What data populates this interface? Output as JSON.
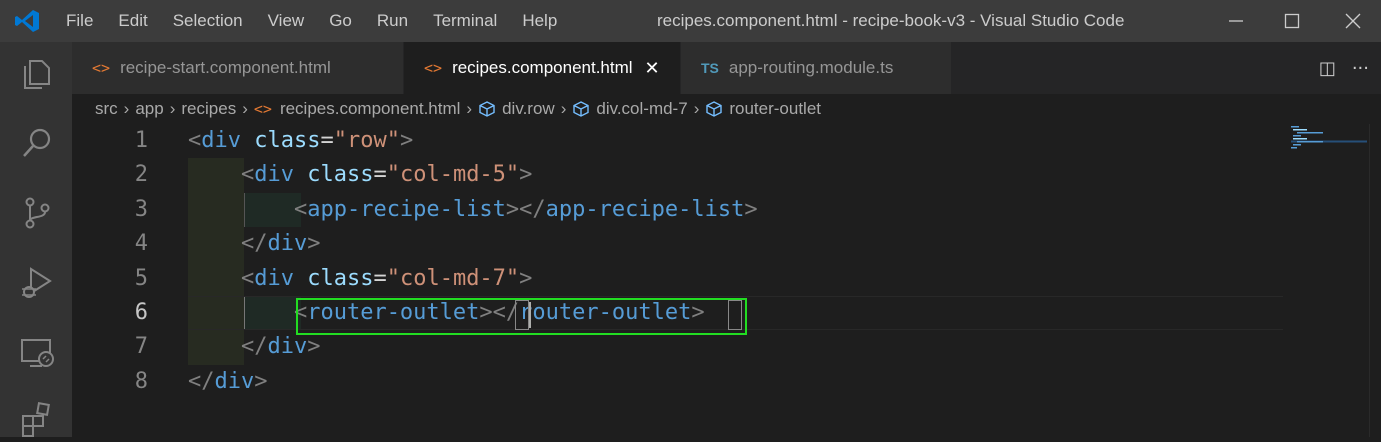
{
  "titlebar": {
    "menu": [
      "File",
      "Edit",
      "Selection",
      "View",
      "Go",
      "Run",
      "Terminal",
      "Help"
    ],
    "window_title": "recipes.component.html - recipe-book-v3 - Visual Studio Code",
    "minimize": "—",
    "maximize": "☐",
    "close": "✕"
  },
  "activity_bar": {
    "items": [
      "explorer-icon",
      "search-icon",
      "source-control-icon",
      "run-debug-icon",
      "remote-explorer-icon",
      "extensions-icon"
    ]
  },
  "tabs": [
    {
      "icon": "<>",
      "label": "recipe-start.component.html",
      "active": false
    },
    {
      "icon": "<>",
      "label": "recipes.component.html",
      "active": true,
      "close": "✕"
    },
    {
      "icon": "TS",
      "label": "app-routing.module.ts",
      "active": false
    }
  ],
  "tab_actions": {
    "split": "◫",
    "more": "···"
  },
  "breadcrumb": {
    "parts": [
      "src",
      "app",
      "recipes",
      "recipes.component.html",
      "div.row",
      "div.col-md-7",
      "router-outlet"
    ],
    "file_icon": "<>",
    "sep": "›"
  },
  "editor": {
    "line_numbers": [
      "1",
      "2",
      "3",
      "4",
      "5",
      "6",
      "7",
      "8"
    ],
    "active_line": "6",
    "lines": [
      [
        [
          "p",
          "<"
        ],
        [
          "t",
          "div"
        ],
        [
          "e",
          " "
        ],
        [
          "a",
          "class"
        ],
        [
          "e",
          "="
        ],
        [
          "s",
          "\"row\""
        ],
        [
          "p",
          ">"
        ]
      ],
      [
        [
          "e",
          "    "
        ],
        [
          "p",
          "<"
        ],
        [
          "t",
          "div"
        ],
        [
          "e",
          " "
        ],
        [
          "a",
          "class"
        ],
        [
          "e",
          "="
        ],
        [
          "s",
          "\"col-md-5\""
        ],
        [
          "p",
          ">"
        ]
      ],
      [
        [
          "e",
          "        "
        ],
        [
          "p",
          "<"
        ],
        [
          "t",
          "app-recipe-list"
        ],
        [
          "p",
          "></"
        ],
        [
          "t",
          "app-recipe-list"
        ],
        [
          "p",
          ">"
        ]
      ],
      [
        [
          "e",
          "    "
        ],
        [
          "p",
          "</"
        ],
        [
          "t",
          "div"
        ],
        [
          "p",
          ">"
        ]
      ],
      [
        [
          "e",
          "    "
        ],
        [
          "p",
          "<"
        ],
        [
          "t",
          "div"
        ],
        [
          "e",
          " "
        ],
        [
          "a",
          "class"
        ],
        [
          "e",
          "="
        ],
        [
          "s",
          "\"col-md-7\""
        ],
        [
          "p",
          ">"
        ]
      ],
      [
        [
          "e",
          "        "
        ],
        [
          "p",
          "<"
        ],
        [
          "t",
          "router-outlet"
        ],
        [
          "p",
          "></"
        ],
        [
          "t",
          "router-outlet"
        ],
        [
          "p",
          ">"
        ]
      ],
      [
        [
          "e",
          "    "
        ],
        [
          "p",
          "</"
        ],
        [
          "t",
          "div"
        ],
        [
          "p",
          ">"
        ]
      ],
      [
        [
          "p",
          "</"
        ],
        [
          "t",
          "div"
        ],
        [
          "p",
          ">"
        ]
      ]
    ]
  },
  "colors": {
    "highlight_box": "#22dd22",
    "tag": "#569cd6",
    "attribute": "#9cdcfe",
    "string": "#ce9178",
    "punctuation": "#808080"
  }
}
